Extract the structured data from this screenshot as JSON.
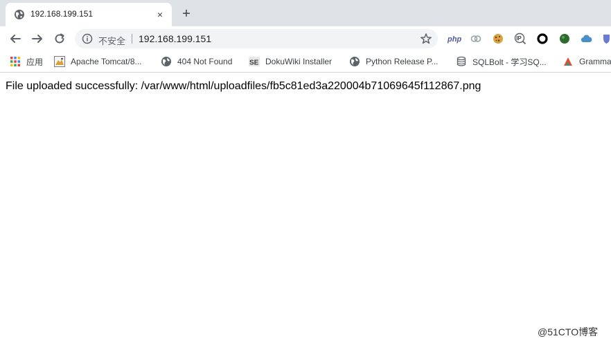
{
  "tab": {
    "title": "192.168.199.151",
    "close_glyph": "×",
    "new_tab_glyph": "+"
  },
  "omnibox": {
    "insecure_label": "不安全",
    "url": "192.168.199.151"
  },
  "extensions": {
    "php_label": "php",
    "ip_label": "IP"
  },
  "bookmarks": [
    {
      "label": "应用",
      "icon": "apps-grid-icon"
    },
    {
      "label": "Apache Tomcat/8...",
      "icon": "tomcat-icon"
    },
    {
      "label": "404 Not Found",
      "icon": "globe-icon"
    },
    {
      "label": "DokuWiki Installer",
      "icon": "dokuwiki-icon",
      "icon_text": "SE"
    },
    {
      "label": "Python Release P...",
      "icon": "globe-icon"
    },
    {
      "label": "SQLBolt - 学习SQ...",
      "icon": "database-icon"
    },
    {
      "label": "Gramma",
      "icon": "grammarly-icon"
    }
  ],
  "page": {
    "message": "File uploaded successfully: /var/www/html/uploadfiles/fb5c81ed3a220004b71069645f112867.png"
  },
  "watermark": "@51CTO博客",
  "colors": {
    "tabbar_bg": "#dee1e6",
    "omnibox_bg": "#f1f3f4",
    "text_primary": "#202124",
    "text_secondary": "#5f6368"
  }
}
